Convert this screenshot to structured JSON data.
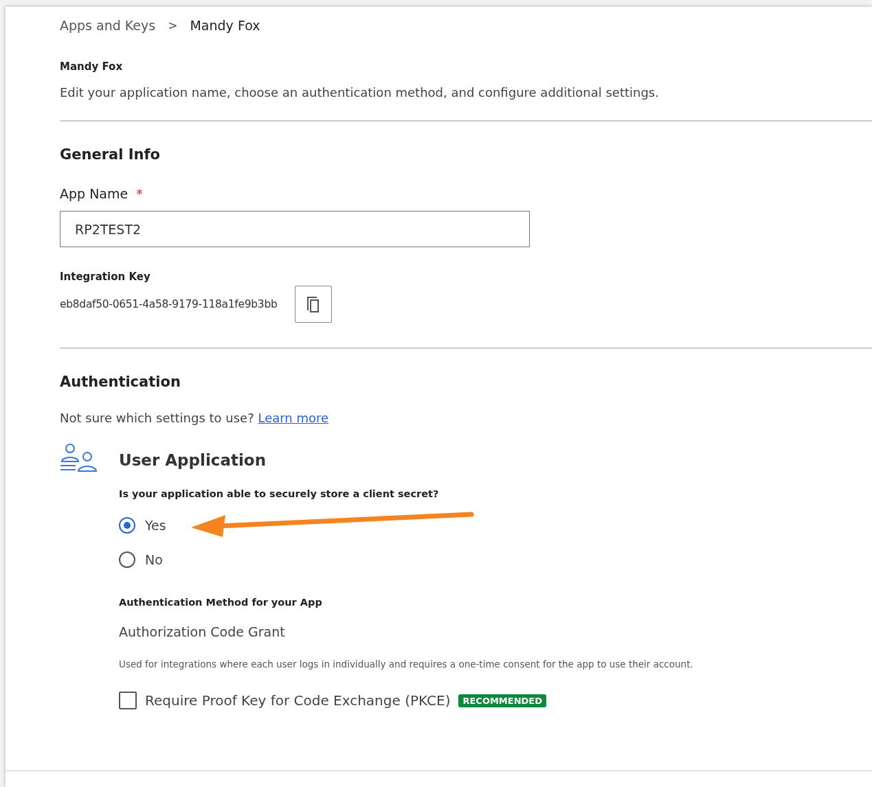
{
  "breadcrumb": [
    {
      "label": "Apps and Keys",
      "current": false
    },
    {
      "label": "Mandy Fox",
      "current": true
    }
  ],
  "breadcrumb_separator": ">",
  "header": {
    "title": "Mandy Fox",
    "description": "Edit your application name, choose an authentication method, and configure additional settings."
  },
  "general_info": {
    "heading": "General Info",
    "app_name": {
      "label": "App Name",
      "required_mark": "*",
      "value": "RP2TEST2"
    },
    "integration_key": {
      "label": "Integration Key",
      "value": "eb8daf50-0651-4a58-9179-118a1fe9b3bb"
    }
  },
  "authentication": {
    "heading": "Authentication",
    "help_text": "Not sure which settings to use?",
    "help_link": "Learn more",
    "app_type": {
      "title": "User Application",
      "question": "Is your application able to securely store a client secret?",
      "options": [
        {
          "label": "Yes",
          "selected": true
        },
        {
          "label": "No",
          "selected": false
        }
      ],
      "method_label": "Authentication Method for your App",
      "method": "Authorization Code Grant",
      "method_description": "Used for integrations where each user logs in individually and requires a one-time consent for the app to use their account.",
      "pkce": {
        "label": "Require Proof Key for Code Exchange (PKCE)",
        "checked": false,
        "badge": "RECOMMENDED"
      }
    }
  },
  "annotation": {
    "kind": "arrow"
  }
}
